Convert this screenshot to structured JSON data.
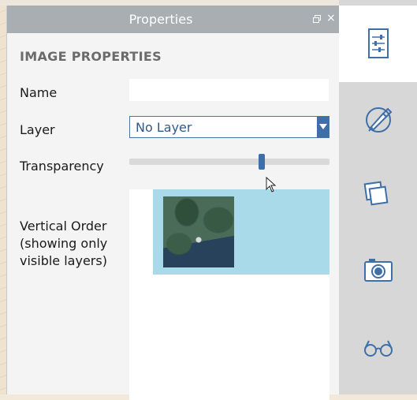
{
  "panel": {
    "title": "Properties",
    "restore_icon": "restore-window-icon",
    "close_icon": "close-icon"
  },
  "section": {
    "title": "IMAGE PROPERTIES"
  },
  "fields": {
    "name_label": "Name",
    "name_value": "",
    "layer_label": "Layer",
    "layer_value": "No Layer",
    "transparency_label": "Transparency",
    "transparency_fraction": 0.66,
    "vertical_order_label_1": "Vertical Order",
    "vertical_order_label_2": "(showing only",
    "vertical_order_label_3": "visible layers)"
  },
  "sidebar": {
    "items": [
      {
        "icon": "properties-sliders-icon",
        "active": true
      },
      {
        "icon": "paint-brush-icon",
        "active": false
      },
      {
        "icon": "layers-icon",
        "active": false
      },
      {
        "icon": "camera-icon",
        "active": false
      },
      {
        "icon": "glasses-icon",
        "active": false
      }
    ]
  },
  "colors": {
    "accent": "#3f6fa8",
    "header": "#a9aeb3",
    "selected_row": "#a9daea",
    "sidebar_bg": "#d7d7d7"
  }
}
